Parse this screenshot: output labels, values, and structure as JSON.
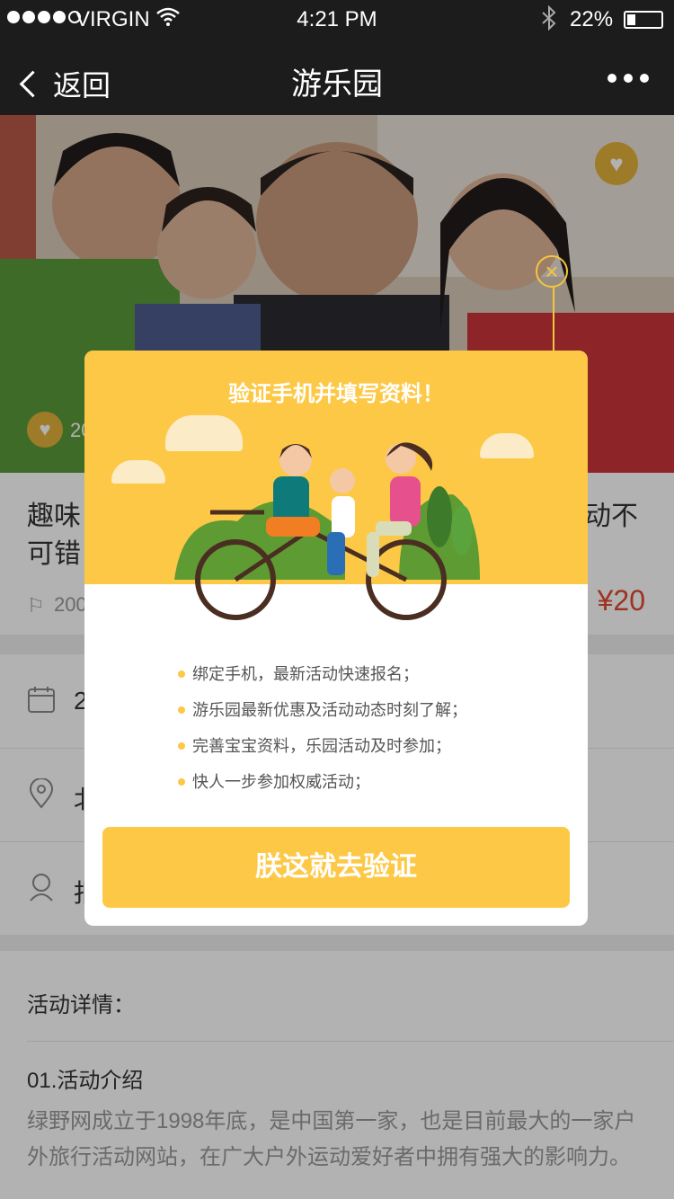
{
  "status": {
    "carrier": "VIRGIN",
    "time": "4:21 PM",
    "battery": "22%",
    "battery_level": 0.22,
    "icons": {
      "wifi": "wifi-icon",
      "bluetooth": "bluetooth-icon",
      "battery": "battery-icon"
    }
  },
  "nav": {
    "back": "返回",
    "title": "游乐园"
  },
  "hero": {
    "fav_count_partial": "20"
  },
  "activity": {
    "title": "趣味…动不可错…",
    "title_visible_left": "趣味",
    "title_visible_right": "动不",
    "title_line2": "可错",
    "count_partial": "200",
    "price": "¥20"
  },
  "info_rows": [
    {
      "icon": "calendar-icon",
      "text": "2"
    },
    {
      "icon": "location-icon",
      "text": "北"
    },
    {
      "icon": "person-icon",
      "text": "报"
    }
  ],
  "details": {
    "heading": "活动详情：",
    "section": "01.活动介绍",
    "paragraph": "绿野网成立于1998年底，是中国第一家，也是目前最大的一家户外旅行活动网站，在广大户外运动爱好者中拥有强大的影响力。"
  },
  "modal": {
    "title": "验证手机并填写资料！",
    "bullets": [
      "绑定手机，最新活动快速报名；",
      "游乐园最新优惠及活动动态时刻了解；",
      "完善宝宝资料，乐园活动及时参加；",
      "快人一步参加权威活动；"
    ],
    "cta": "朕这就去验证"
  },
  "colors": {
    "accent": "#fdc846",
    "price": "#e0492f",
    "nav_bg": "#1c1c1c"
  }
}
